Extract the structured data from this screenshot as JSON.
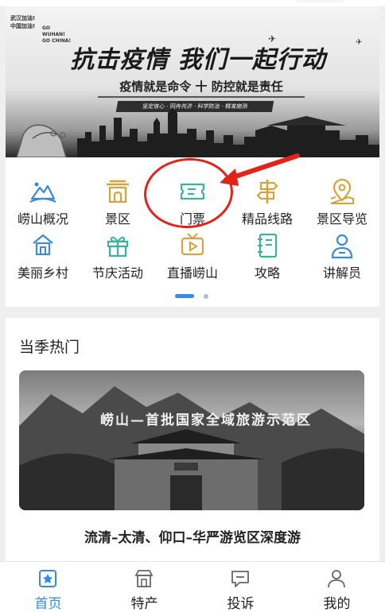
{
  "banner": {
    "badge_cn_1": "武汉加油!",
    "badge_cn_2": "中国加油!",
    "badge_en_1": "GO WUHAN!",
    "badge_en_2": "GO CHINA!",
    "headline": "抗击疫情 我们一起行动",
    "subline": "疫情就是命令 十 防控就是责任",
    "ribbon": "坚定信心 · 同舟共济 · 科学防治 · 精准施测"
  },
  "grid": {
    "items": [
      {
        "label": "崂山概况",
        "icon": "mountain-icon"
      },
      {
        "label": "景区",
        "icon": "gate-icon"
      },
      {
        "label": "门票",
        "icon": "ticket-icon"
      },
      {
        "label": "精品线路",
        "icon": "signpost-icon"
      },
      {
        "label": "景区导览",
        "icon": "map-pin-icon"
      },
      {
        "label": "美丽乡村",
        "icon": "village-icon"
      },
      {
        "label": "节庆活动",
        "icon": "gift-icon"
      },
      {
        "label": "直播崂山",
        "icon": "live-tv-icon"
      },
      {
        "label": "攻略",
        "icon": "notebook-icon"
      },
      {
        "label": "讲解员",
        "icon": "guide-icon"
      }
    ]
  },
  "hot": {
    "section_title": "当季热门",
    "image_caption": "崂山—首批国家全域旅游示范区",
    "item_title": "流清–太清、仰口–华严游览区深度游"
  },
  "tabbar": {
    "tabs": [
      {
        "label": "首页",
        "icon": "home-icon",
        "active": true
      },
      {
        "label": "特产",
        "icon": "shop-icon",
        "active": false
      },
      {
        "label": "投诉",
        "icon": "message-icon",
        "active": false
      },
      {
        "label": "我的",
        "icon": "user-icon",
        "active": false
      }
    ]
  },
  "colors": {
    "accent": "#2f8bf0",
    "icon_gold": "#d6a23c",
    "icon_green": "#3ab39a",
    "icon_blue": "#3a8ad8",
    "highlight_red": "#e2231a"
  }
}
